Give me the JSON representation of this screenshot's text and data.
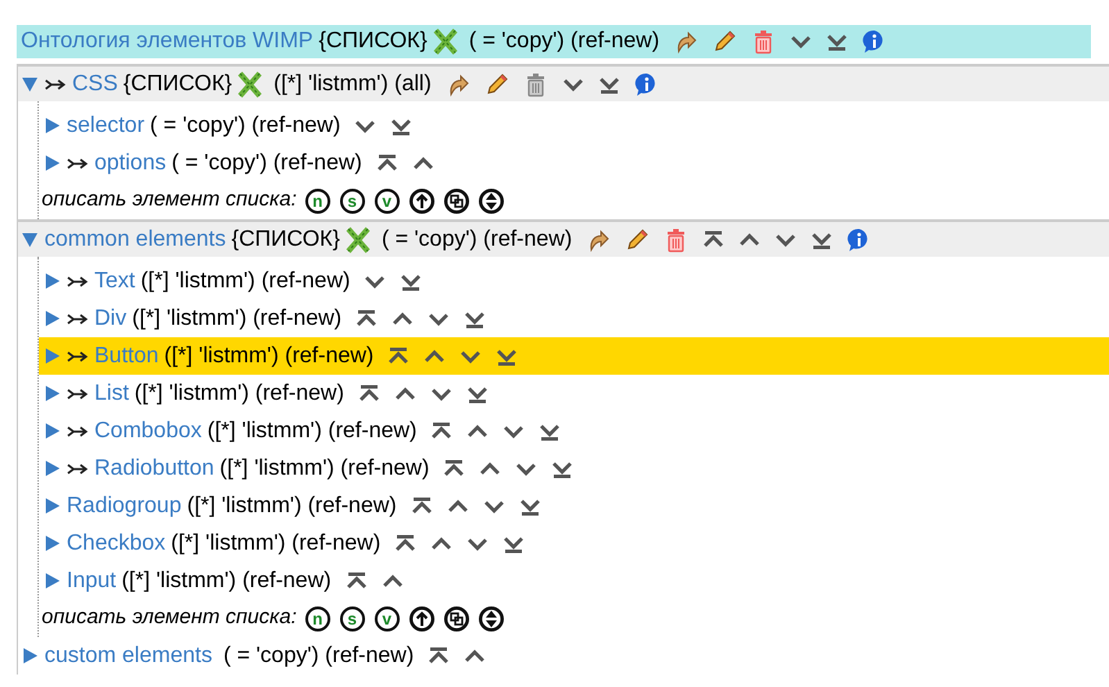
{
  "root": {
    "name": "Онтология элементов WIMP",
    "tag": "{СПИСОК}",
    "params": "( = 'copy') (ref-new)",
    "actions": [
      {
        "kind": "replace",
        "disabled": false
      },
      {
        "kind": "edit",
        "disabled": false
      },
      {
        "kind": "delete",
        "disabled": false
      },
      {
        "kind": "down",
        "disabled": false
      },
      {
        "kind": "bottom",
        "disabled": false
      },
      {
        "kind": "info",
        "disabled": false
      }
    ]
  },
  "sections": [
    {
      "name": "CSS",
      "expanded": true,
      "linked": true,
      "tag": "{СПИСОК}",
      "params": "([*] 'listmm') (all)",
      "actions": [
        {
          "kind": "replace",
          "disabled": false
        },
        {
          "kind": "edit",
          "disabled": false
        },
        {
          "kind": "delete",
          "disabled": true
        },
        {
          "kind": "down",
          "disabled": false
        },
        {
          "kind": "bottom",
          "disabled": false
        },
        {
          "kind": "info",
          "disabled": false
        }
      ],
      "items": [
        {
          "name": "selector",
          "linked": false,
          "expanded": false,
          "selected": false,
          "params": "( = 'copy') (ref-new)",
          "actions": [
            {
              "kind": "down"
            },
            {
              "kind": "bottom"
            }
          ]
        },
        {
          "name": "options",
          "linked": true,
          "expanded": false,
          "selected": false,
          "params": "( = 'copy') (ref-new)",
          "actions": [
            {
              "kind": "top"
            },
            {
              "kind": "up"
            }
          ]
        }
      ],
      "describe": {
        "label": "описать элемент списка:",
        "buttons": [
          {
            "kind": "letter",
            "label": "n"
          },
          {
            "kind": "letter",
            "label": "s"
          },
          {
            "kind": "letter",
            "label": "v"
          },
          {
            "kind": "up"
          },
          {
            "kind": "copy"
          },
          {
            "kind": "updown"
          }
        ]
      }
    },
    {
      "name": "common elements",
      "expanded": true,
      "linked": false,
      "tag": "{СПИСОК}",
      "params": "( = 'copy') (ref-new)",
      "actions": [
        {
          "kind": "replace",
          "disabled": false
        },
        {
          "kind": "edit",
          "disabled": false
        },
        {
          "kind": "delete",
          "disabled": false
        },
        {
          "kind": "top",
          "disabled": false
        },
        {
          "kind": "up",
          "disabled": false
        },
        {
          "kind": "down",
          "disabled": false
        },
        {
          "kind": "bottom",
          "disabled": false
        },
        {
          "kind": "info",
          "disabled": false
        }
      ],
      "items": [
        {
          "name": "Text",
          "linked": true,
          "expanded": false,
          "selected": false,
          "params": "([*] 'listmm') (ref-new)",
          "actions": [
            {
              "kind": "down"
            },
            {
              "kind": "bottom"
            }
          ]
        },
        {
          "name": "Div",
          "linked": true,
          "expanded": false,
          "selected": false,
          "params": "([*] 'listmm') (ref-new)",
          "actions": [
            {
              "kind": "top"
            },
            {
              "kind": "up"
            },
            {
              "kind": "down"
            },
            {
              "kind": "bottom"
            }
          ]
        },
        {
          "name": "Button",
          "linked": true,
          "expanded": false,
          "selected": true,
          "params": "([*] 'listmm') (ref-new)",
          "actions": [
            {
              "kind": "top"
            },
            {
              "kind": "up"
            },
            {
              "kind": "down"
            },
            {
              "kind": "bottom"
            }
          ]
        },
        {
          "name": "List",
          "linked": true,
          "expanded": false,
          "selected": false,
          "params": "([*] 'listmm') (ref-new)",
          "actions": [
            {
              "kind": "top"
            },
            {
              "kind": "up"
            },
            {
              "kind": "down"
            },
            {
              "kind": "bottom"
            }
          ]
        },
        {
          "name": "Combobox",
          "linked": true,
          "expanded": false,
          "selected": false,
          "params": "([*] 'listmm') (ref-new)",
          "actions": [
            {
              "kind": "top"
            },
            {
              "kind": "up"
            },
            {
              "kind": "down"
            },
            {
              "kind": "bottom"
            }
          ]
        },
        {
          "name": "Radiobutton",
          "linked": true,
          "expanded": false,
          "selected": false,
          "params": "([*] 'listmm') (ref-new)",
          "actions": [
            {
              "kind": "top"
            },
            {
              "kind": "up"
            },
            {
              "kind": "down"
            },
            {
              "kind": "bottom"
            }
          ]
        },
        {
          "name": "Radiogroup",
          "linked": false,
          "expanded": false,
          "selected": false,
          "params": "([*] 'listmm') (ref-new)",
          "actions": [
            {
              "kind": "top"
            },
            {
              "kind": "up"
            },
            {
              "kind": "down"
            },
            {
              "kind": "bottom"
            }
          ]
        },
        {
          "name": "Checkbox",
          "linked": false,
          "expanded": false,
          "selected": false,
          "params": "([*] 'listmm') (ref-new)",
          "actions": [
            {
              "kind": "top"
            },
            {
              "kind": "up"
            },
            {
              "kind": "down"
            },
            {
              "kind": "bottom"
            }
          ]
        },
        {
          "name": "Input",
          "linked": false,
          "expanded": false,
          "selected": false,
          "params": "([*] 'listmm') (ref-new)",
          "actions": [
            {
              "kind": "top"
            },
            {
              "kind": "up"
            }
          ]
        }
      ],
      "describe": {
        "label": "описать элемент списка:",
        "buttons": [
          {
            "kind": "letter",
            "label": "n"
          },
          {
            "kind": "letter",
            "label": "s"
          },
          {
            "kind": "letter",
            "label": "v"
          },
          {
            "kind": "up"
          },
          {
            "kind": "copy"
          },
          {
            "kind": "updown"
          }
        ]
      }
    },
    {
      "name": "custom elements",
      "expanded": false,
      "linked": false,
      "params": "( = 'copy') (ref-new)",
      "actions": [
        {
          "kind": "top",
          "disabled": false
        },
        {
          "kind": "up",
          "disabled": false
        }
      ]
    }
  ]
}
